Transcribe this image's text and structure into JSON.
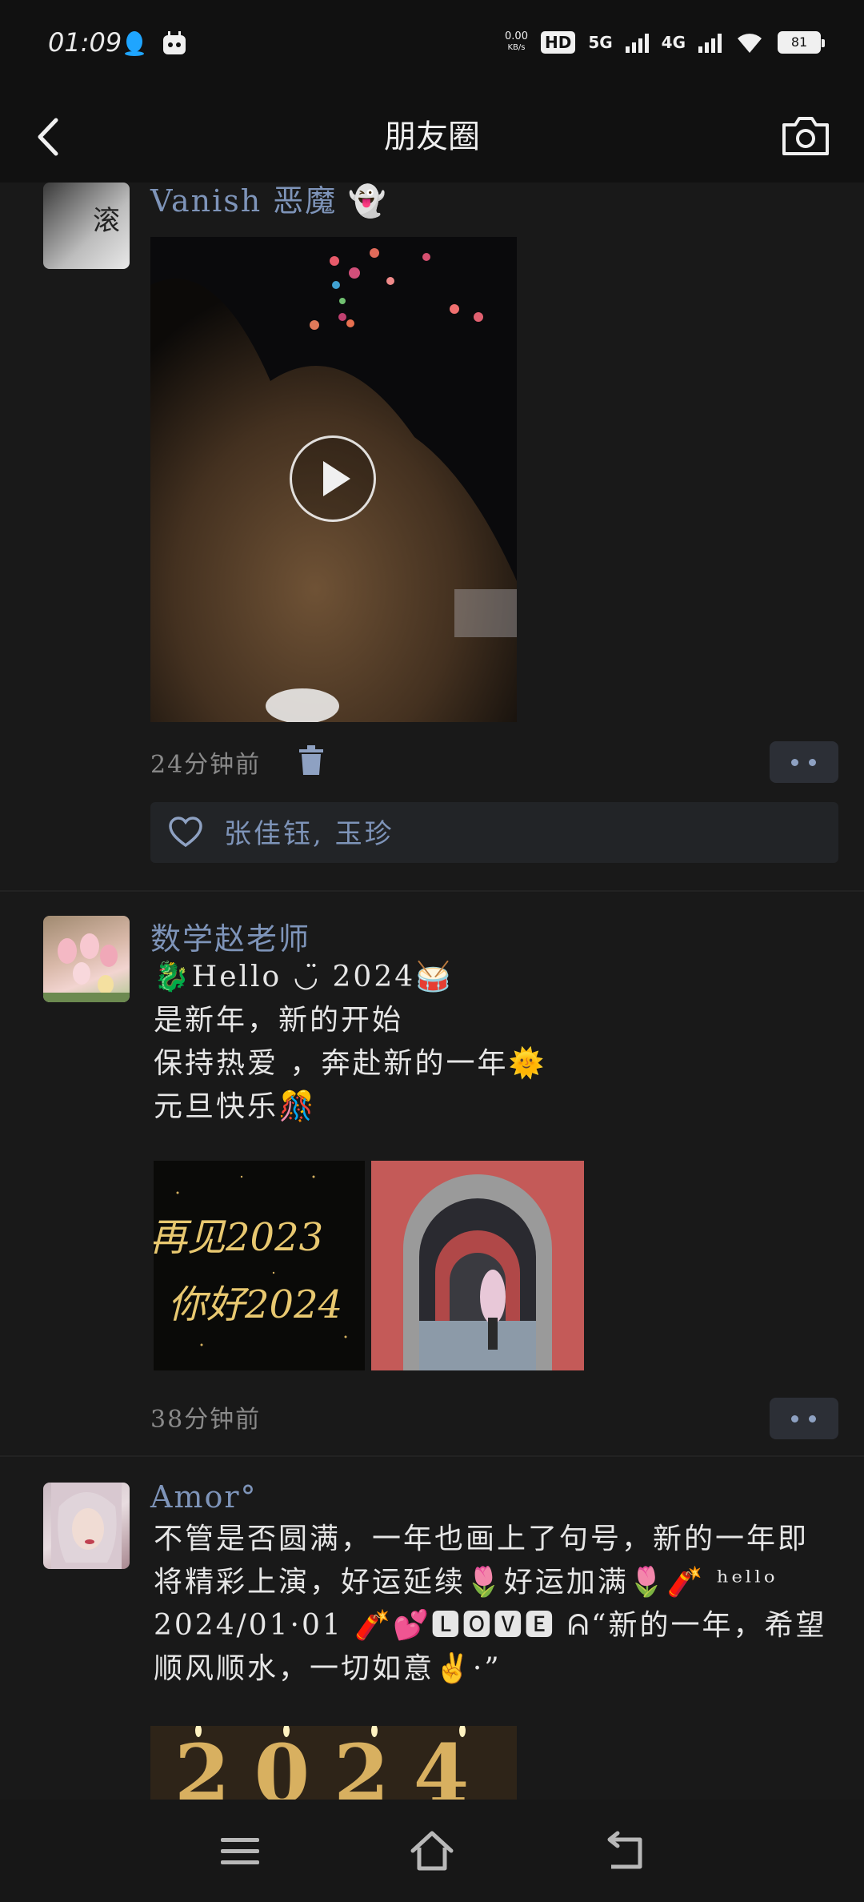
{
  "status_bar": {
    "time": "01:09",
    "net_speed_value": "0.00",
    "net_speed_unit": "KB/s",
    "hd_label": "HD",
    "sim1_label": "5G",
    "sim2_label": "4G",
    "battery_level": "81"
  },
  "header": {
    "title": "朋友圈"
  },
  "posts": [
    {
      "author": "Vanish 恶魔 👻",
      "avatar_text": "滚",
      "time": "24分钟前",
      "likes": "张佳钰, 玉珍"
    },
    {
      "author": "数学赵老师",
      "text_line1": "🐉Hello ◡̈ 2024🥁",
      "text_line2": "是新年，新的开始",
      "text_line3": "保持热爱 ，奔赴新的一年🌞",
      "text_line4": "元旦快乐🎊",
      "image1_text_a": "再见2023",
      "image1_text_b": "你好2024",
      "time": "38分钟前"
    },
    {
      "author": "Amor°",
      "text": "不管是否圆满，一年也画上了句号，新的一年即将精彩上演，好运延续🌷好运加满🌷🧨 ʰᵉˡˡᵒ 2024/01·01 🧨💕🅻🅾🆅🅴 ᕱ“新的一年，希望顺风顺水，一切如意✌️·”",
      "image_text": "2024"
    }
  ],
  "colors": {
    "background": "#191919",
    "name_blue": "#7e94b9",
    "bar_dark": "#111111"
  }
}
